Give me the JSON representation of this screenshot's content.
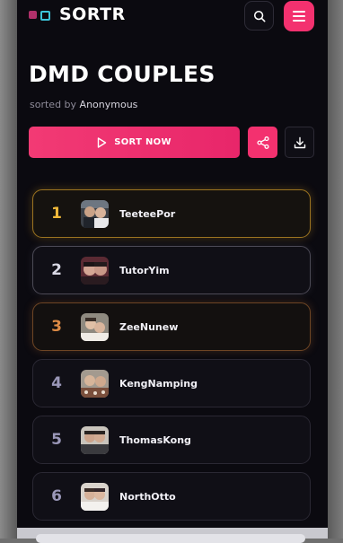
{
  "header": {
    "logo_text": "SORTR",
    "search_icon": "search-icon",
    "menu_icon": "hamburger-menu-icon"
  },
  "page": {
    "title": "DMD COUPLES",
    "sorted_by_prefix": "sorted by",
    "author": "Anonymous"
  },
  "actions": {
    "sort_label": "SORT NOW",
    "sort_icon": "play-icon",
    "share_icon": "share-icon",
    "download_icon": "download-icon"
  },
  "colors": {
    "accent": "#f3316f",
    "background": "#0b0a10",
    "gold": "#f0b93a",
    "silver": "#d8d8e4",
    "bronze": "#dc8a45"
  },
  "rankings": [
    {
      "rank": "1",
      "name": "TeeteePor"
    },
    {
      "rank": "2",
      "name": "TutorYim"
    },
    {
      "rank": "3",
      "name": "ZeeNunew"
    },
    {
      "rank": "4",
      "name": "KengNamping"
    },
    {
      "rank": "5",
      "name": "ThomasKong"
    },
    {
      "rank": "6",
      "name": "NorthOtto"
    }
  ]
}
